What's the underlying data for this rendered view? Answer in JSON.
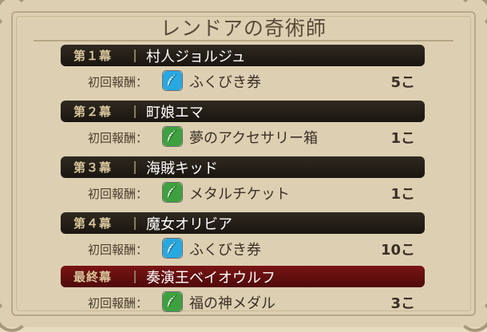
{
  "title": "レンドアの奇術師",
  "colors": {
    "ticket_icon": "#28a8e0",
    "medal_icon": "#3fa040",
    "bar_normal": "#221d16",
    "bar_final": "#6a1010"
  },
  "chapters": [
    {
      "act": "第１幕",
      "name": "村人ジョルジュ",
      "reward_label": "初回報酬：",
      "icon": "blue-feather-icon",
      "item": "ふくびき券",
      "qty": "5こ",
      "final": false
    },
    {
      "act": "第２幕",
      "name": "町娘エマ",
      "reward_label": "初回報酬：",
      "icon": "green-feather-icon",
      "item": "夢のアクセサリー箱",
      "qty": "1こ",
      "final": false
    },
    {
      "act": "第３幕",
      "name": "海賊キッド",
      "reward_label": "初回報酬：",
      "icon": "green-feather-icon",
      "item": "メタルチケット",
      "qty": "1こ",
      "final": false
    },
    {
      "act": "第４幕",
      "name": "魔女オリビア",
      "reward_label": "初回報酬：",
      "icon": "blue-feather-icon",
      "item": "ふくびき券",
      "qty": "10こ",
      "final": false
    },
    {
      "act": "最終幕",
      "name": "奏演王ベイオウルフ",
      "reward_label": "初回報酬：",
      "icon": "green-feather-icon",
      "item": "福の神メダル",
      "qty": "3こ",
      "final": true
    }
  ]
}
